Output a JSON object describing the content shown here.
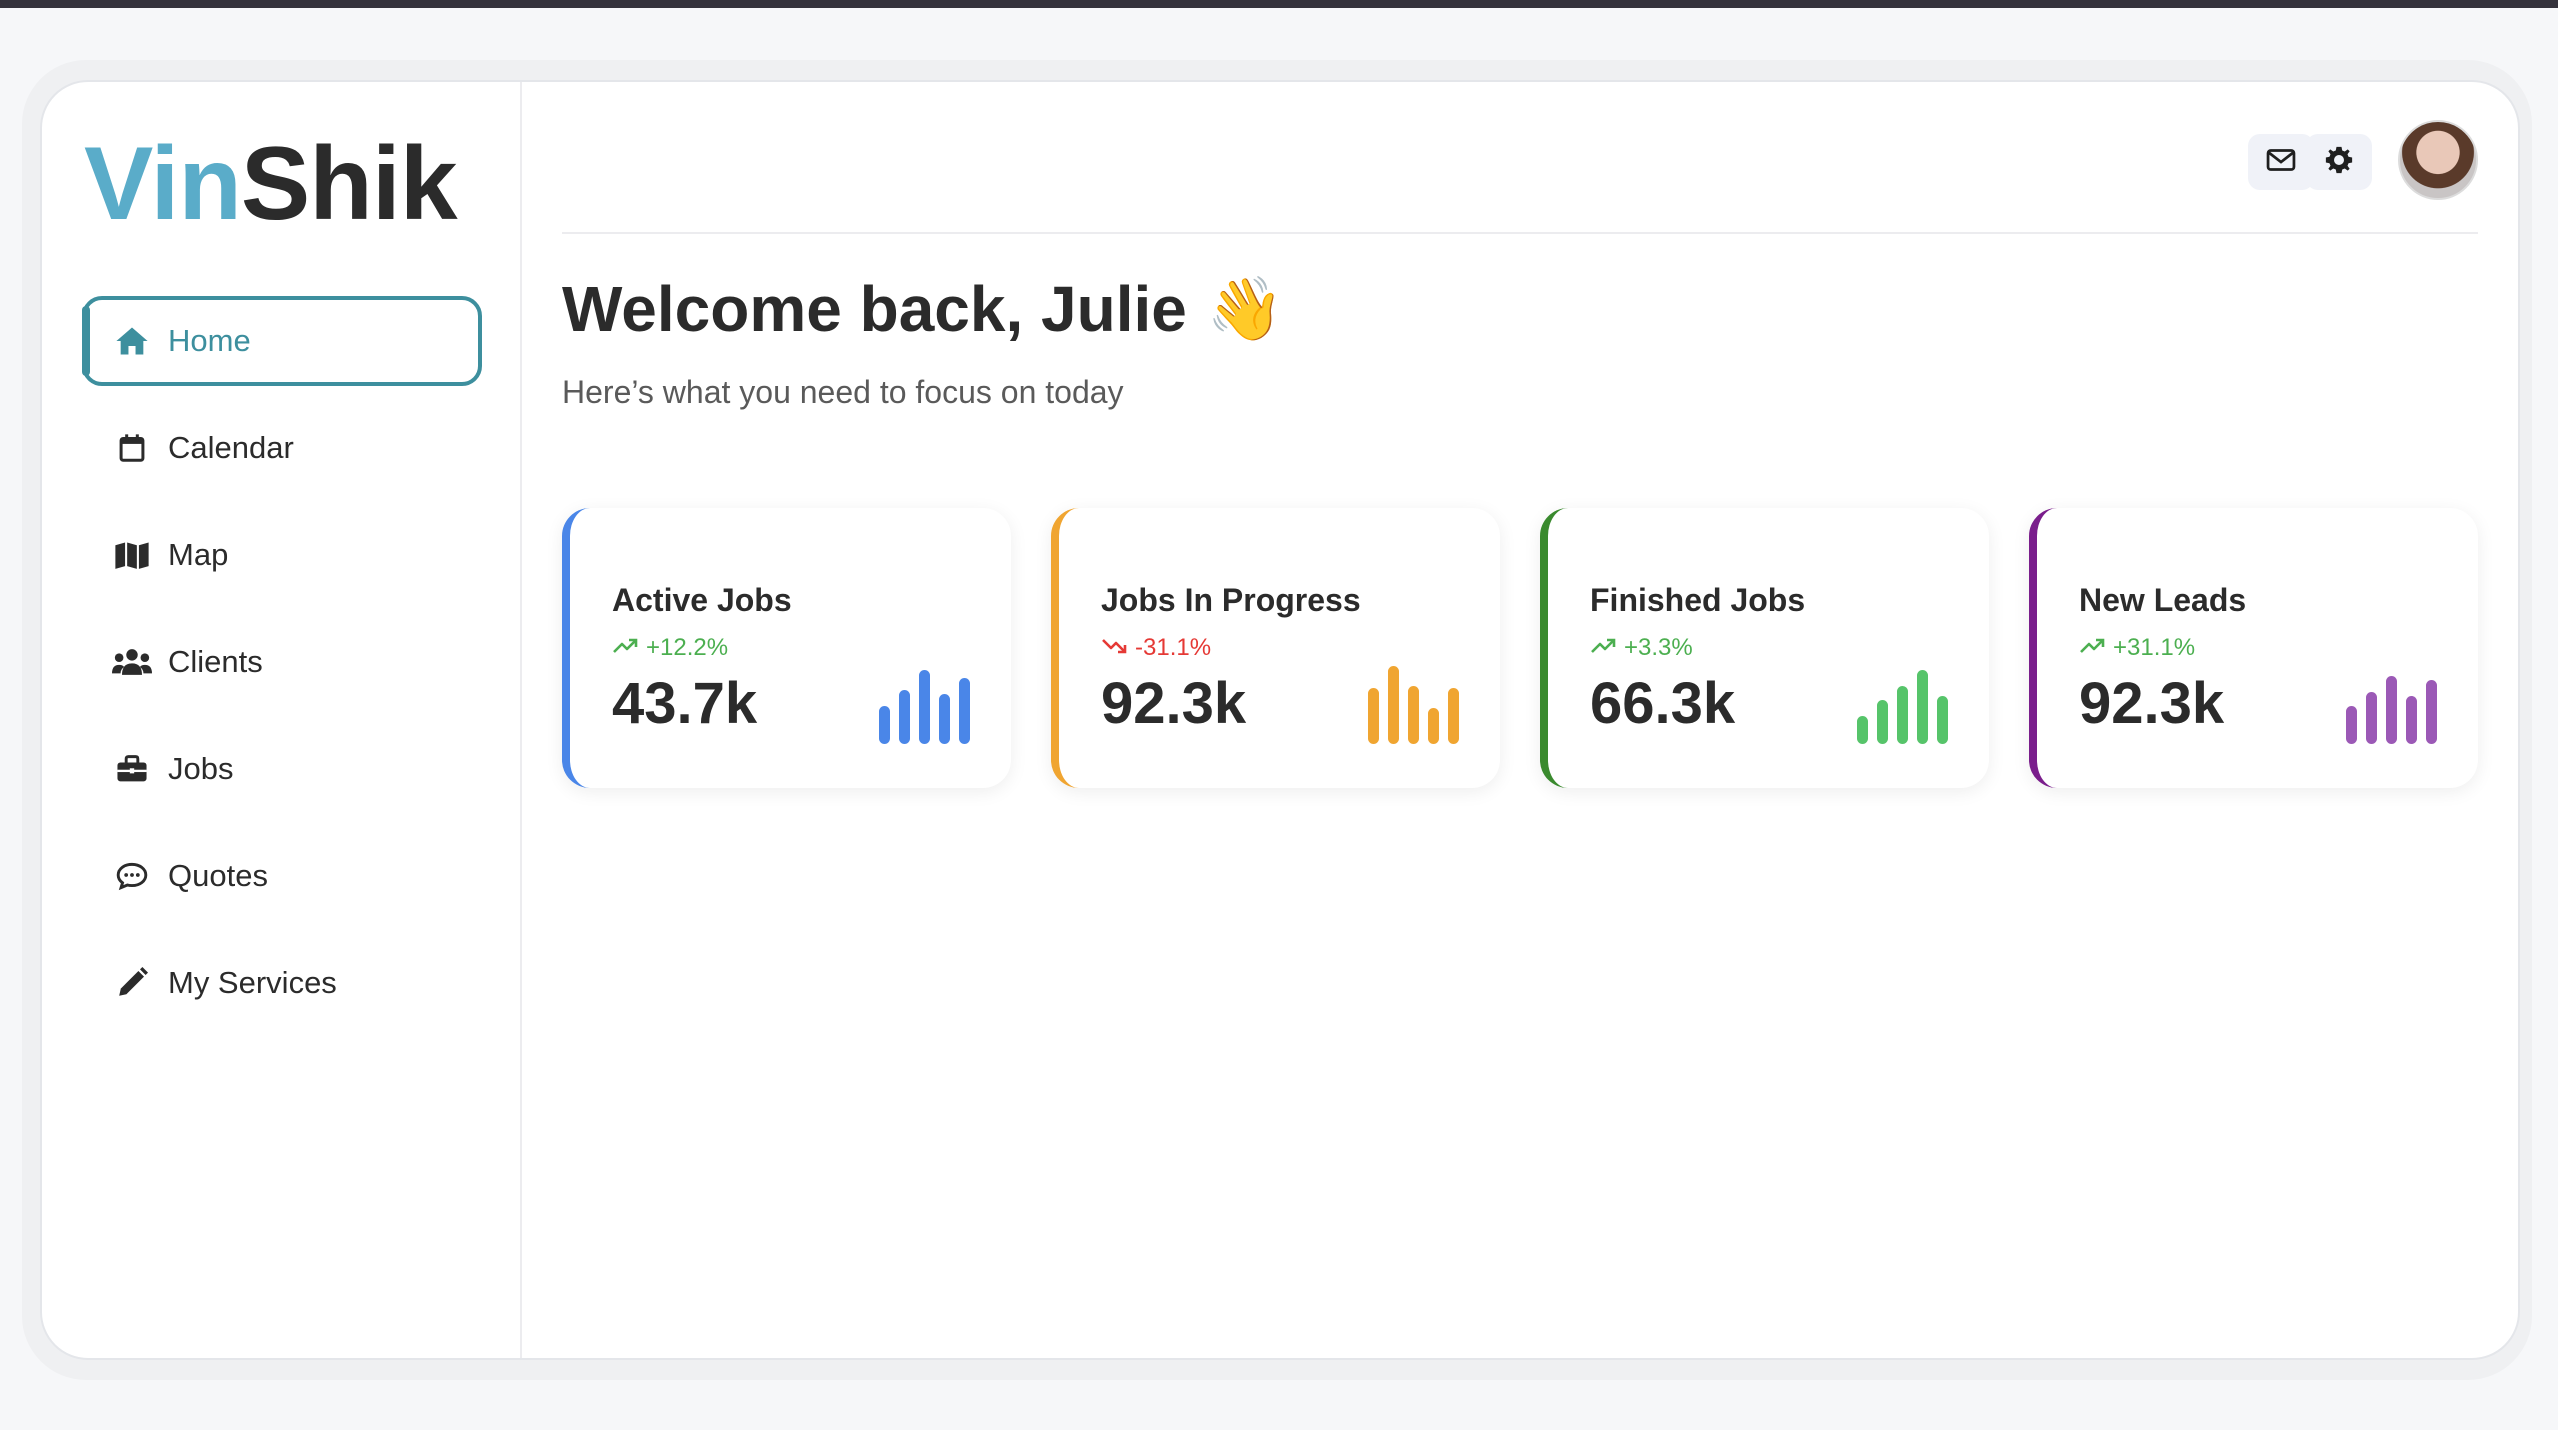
{
  "app": {
    "logo_part1": "Vin",
    "logo_part2": "Shik"
  },
  "sidebar": {
    "items": [
      {
        "label": "Home",
        "icon": "home-icon",
        "active": true
      },
      {
        "label": "Calendar",
        "icon": "calendar-icon",
        "active": false
      },
      {
        "label": "Map",
        "icon": "map-icon",
        "active": false
      },
      {
        "label": "Clients",
        "icon": "clients-icon",
        "active": false
      },
      {
        "label": "Jobs",
        "icon": "briefcase-icon",
        "active": false
      },
      {
        "label": "Quotes",
        "icon": "chat-bubble-icon",
        "active": false
      },
      {
        "label": "My Services",
        "icon": "pencil-icon",
        "active": false
      }
    ]
  },
  "header": {
    "mail_icon": "mail-icon",
    "settings_icon": "gear-icon",
    "avatar": "user-avatar"
  },
  "main": {
    "welcome": "Welcome back, Julie",
    "wave_emoji": "👋",
    "subtitle": "Here’s what you need to focus on today"
  },
  "cards": [
    {
      "title": "Active Jobs",
      "trend": "+12.2%",
      "direction": "up",
      "value": "43.7k",
      "color": "#4a86e8",
      "trend_color": "#4caf50"
    },
    {
      "title": "Jobs In Progress",
      "trend": "-31.1%",
      "direction": "down",
      "value": "92.3k",
      "color": "#f0a531",
      "trend_color": "#e53935"
    },
    {
      "title": "Finished Jobs",
      "trend": "+3.3%",
      "direction": "up",
      "value": "66.3k",
      "color": "#3a8a2e",
      "trend_color": "#4caf50",
      "bar_color": "#56c46a"
    },
    {
      "title": "New Leads",
      "trend": "+31.1%",
      "direction": "up",
      "value": "92.3k",
      "color": "#7a1e8c",
      "trend_color": "#4caf50",
      "bar_color": "#9b59b6"
    }
  ],
  "colors": {
    "accent": "#3d8f9e",
    "logo_accent": "#5aacc9"
  }
}
